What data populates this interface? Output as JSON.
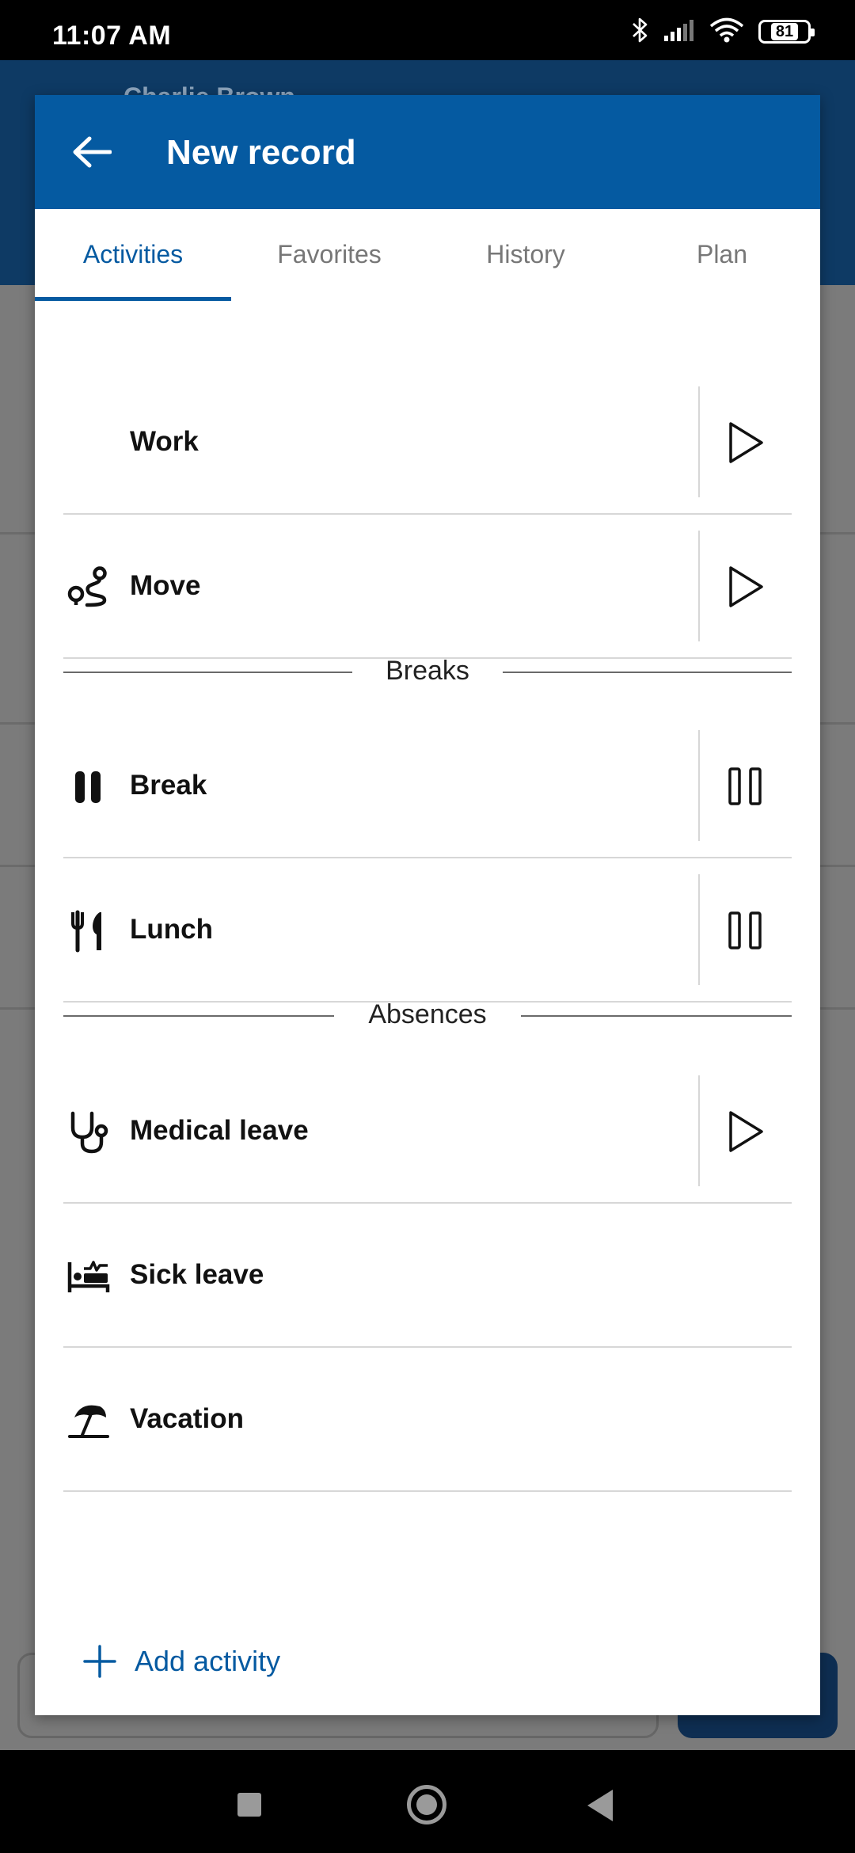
{
  "status_bar": {
    "time": "11:07 AM",
    "battery": "81",
    "icons": [
      "bluetooth-icon",
      "signal-icon",
      "wifi-icon",
      "battery-icon"
    ]
  },
  "background": {
    "user_name": "Charlie Brown"
  },
  "modal": {
    "title": "New record",
    "tabs": [
      {
        "label": "Activities",
        "active": true
      },
      {
        "label": "Favorites",
        "active": false
      },
      {
        "label": "History",
        "active": false
      },
      {
        "label": "Plan",
        "active": false
      }
    ],
    "activities": [
      {
        "label": "Work",
        "icon": "none",
        "action": "play"
      },
      {
        "label": "Move",
        "icon": "route-icon",
        "action": "play"
      }
    ],
    "breaks_section": "Breaks",
    "breaks": [
      {
        "label": "Break",
        "icon": "pause-icon",
        "action": "pause"
      },
      {
        "label": "Lunch",
        "icon": "cutlery-icon",
        "action": "pause"
      }
    ],
    "absences_section": "Absences",
    "absences": [
      {
        "label": "Medical leave",
        "icon": "stethoscope-icon",
        "action": "play"
      },
      {
        "label": "Sick leave",
        "icon": "sick-bed-icon",
        "action": "none"
      },
      {
        "label": "Vacation",
        "icon": "beach-umbrella-icon",
        "action": "none"
      }
    ],
    "add_activity": "Add activity"
  },
  "colors": {
    "primary": "#055aa1",
    "status_bar": "#000000",
    "divider": "#d7d7d7"
  }
}
